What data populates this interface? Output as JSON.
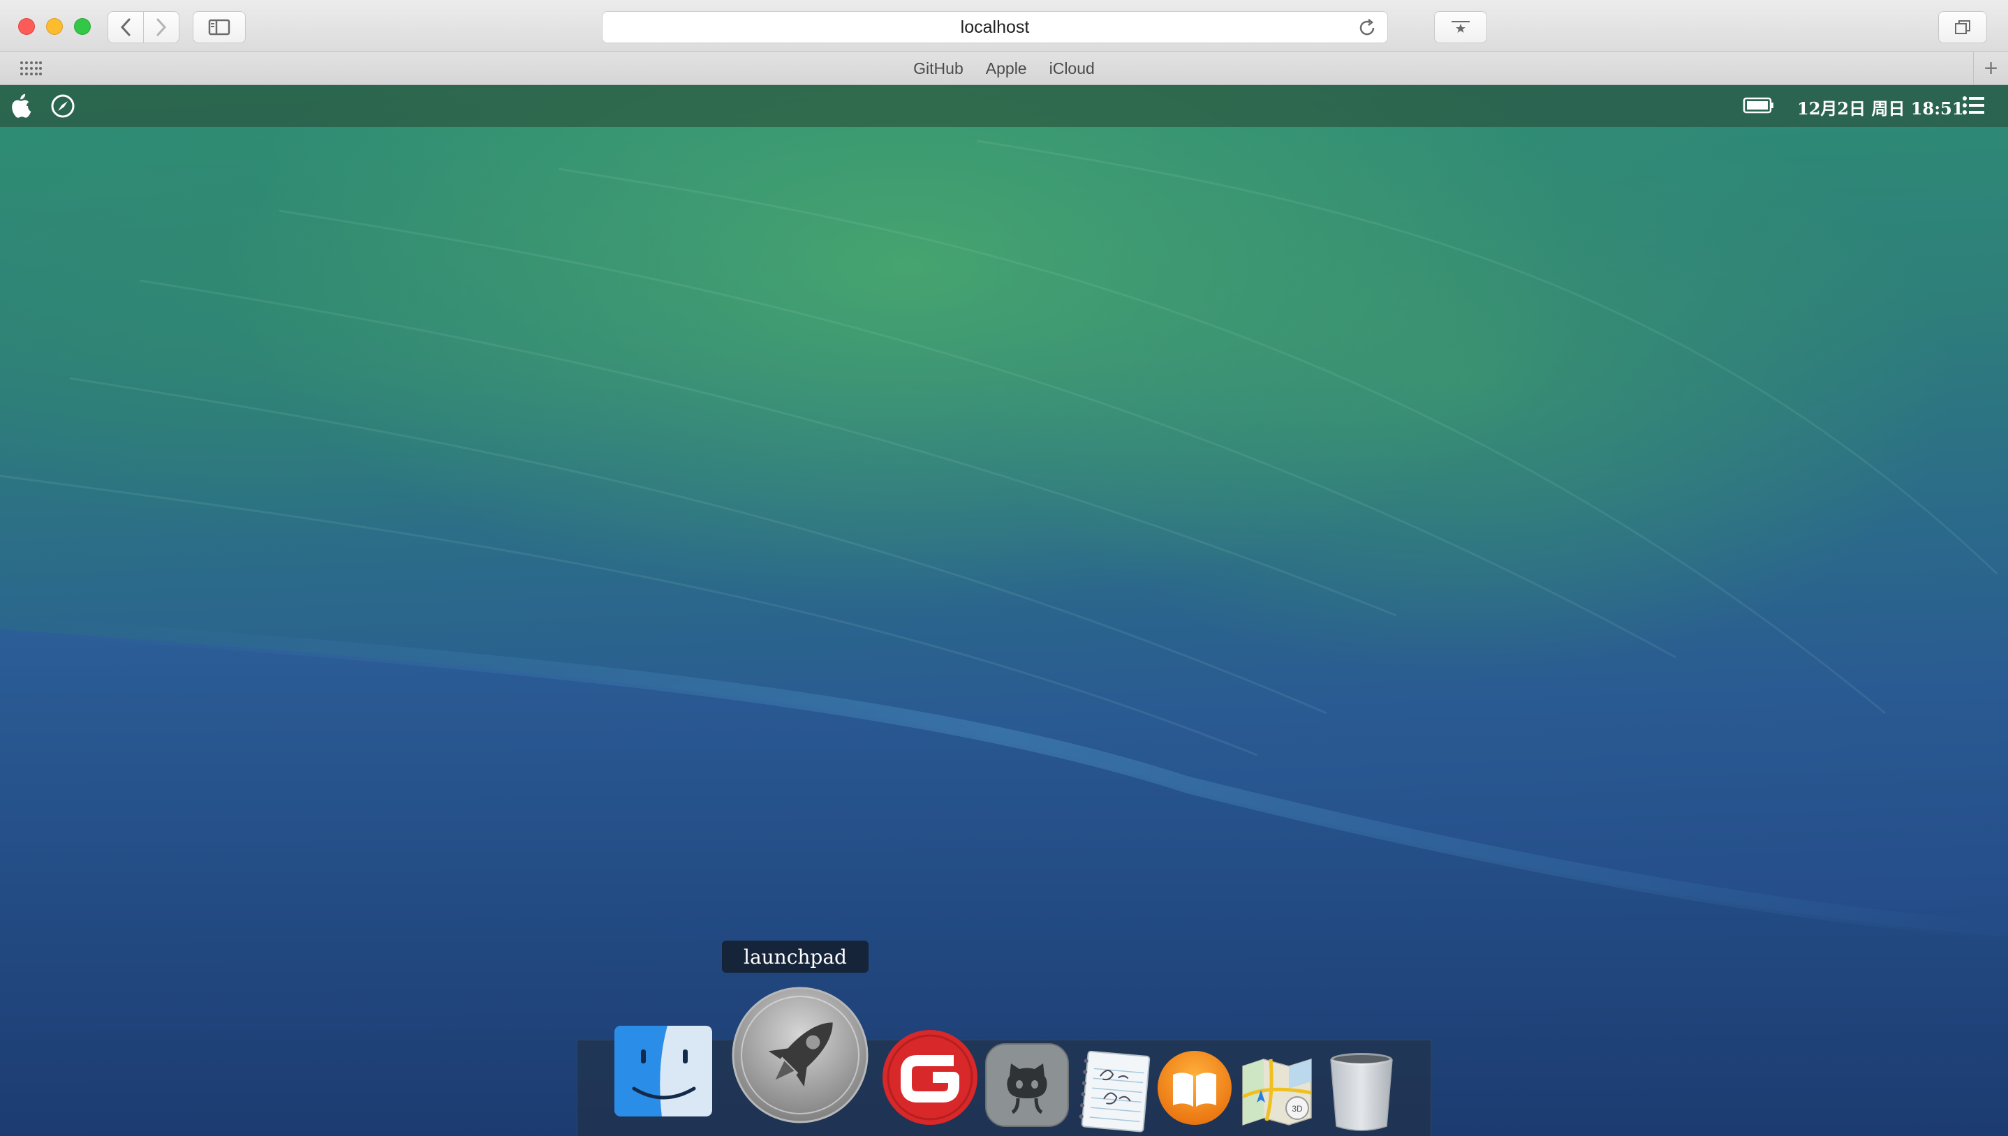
{
  "browser": {
    "url": "localhost",
    "favorites": [
      "GitHub",
      "Apple",
      "iCloud"
    ],
    "add_tab_label": "+"
  },
  "menubar": {
    "clock": "12月2日 周日 18:51"
  },
  "dock": {
    "tooltip": "launchpad",
    "items": [
      {
        "icon": "finder-icon"
      },
      {
        "icon": "launchpad-icon"
      },
      {
        "icon": "g-app-icon"
      },
      {
        "icon": "github-icon"
      },
      {
        "icon": "diary-icon"
      },
      {
        "icon": "ibooks-icon"
      },
      {
        "icon": "maps-icon"
      },
      {
        "icon": "trash-icon"
      }
    ]
  },
  "colors": {
    "close": "#fc5b57",
    "minimize": "#fdbc2e",
    "maximize": "#33c748"
  }
}
